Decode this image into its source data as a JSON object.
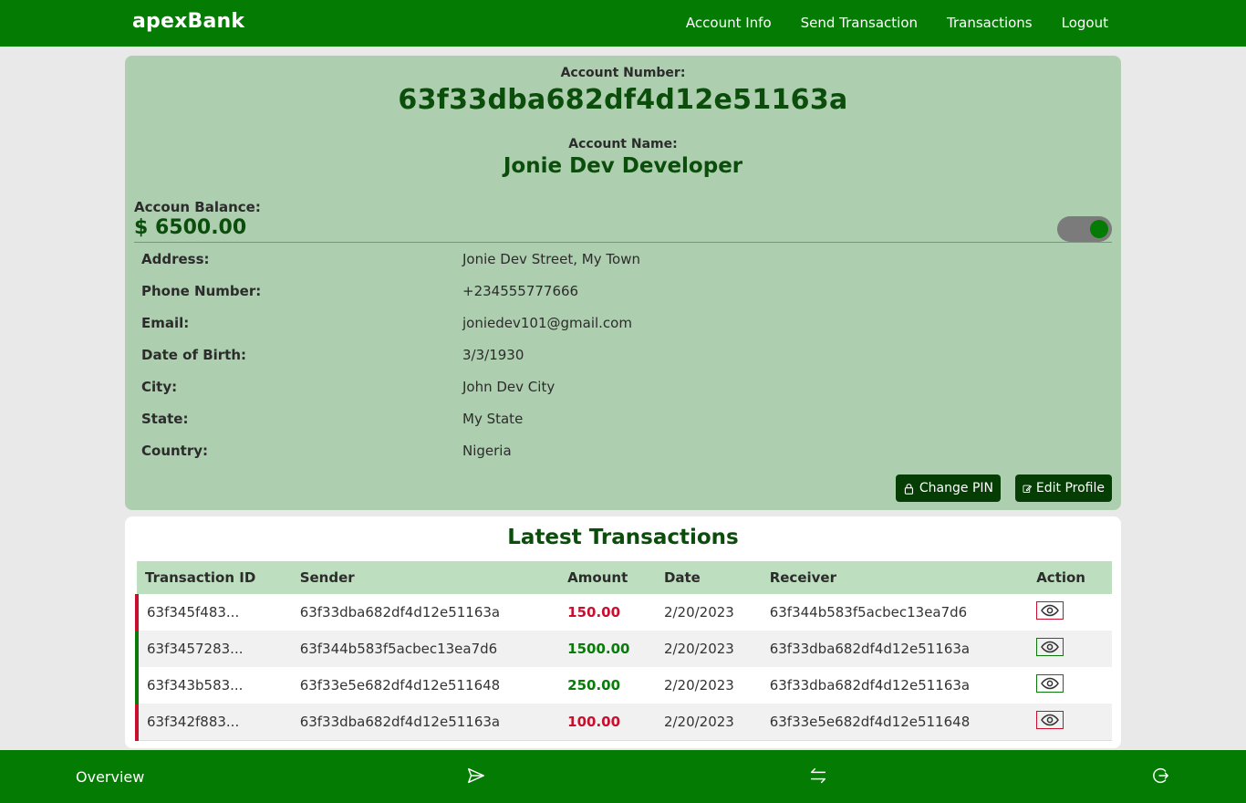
{
  "header": {
    "brand": "apexBank",
    "nav": [
      "Account Info",
      "Send Transaction",
      "Transactions",
      "Logout"
    ]
  },
  "account": {
    "number_label": "Account Number:",
    "number": "63f33dba682df4d12e51163a",
    "name_label": "Account Name:",
    "name": "Jonie Dev Developer",
    "balance_label": "Accoun Balance:",
    "balance": "$ 6500.00",
    "balance_visible_toggle": "on",
    "details": [
      {
        "label": "Address:",
        "value": "Jonie Dev Street, My Town"
      },
      {
        "label": "Phone Number:",
        "value": "+234555777666"
      },
      {
        "label": "Email:",
        "value": "joniedev101@gmail.com"
      },
      {
        "label": "Date of Birth:",
        "value": "3/3/1930"
      },
      {
        "label": "City:",
        "value": "John Dev City"
      },
      {
        "label": "State:",
        "value": "My State"
      },
      {
        "label": "Country:",
        "value": "Nigeria"
      }
    ],
    "change_pin_label": "Change PIN",
    "edit_profile_label": "Edit Profile"
  },
  "transactions": {
    "title": "Latest Transactions",
    "columns": [
      "Transaction ID",
      "Sender",
      "Amount",
      "Date",
      "Receiver",
      "Action"
    ],
    "rows": [
      {
        "id": "63f345f483...",
        "sender": "63f33dba682df4d12e51163a",
        "amount": "150.00",
        "date": "2/20/2023",
        "receiver": "63f344b583f5acbec13ea7d6",
        "type": "debit"
      },
      {
        "id": "63f3457283...",
        "sender": "63f344b583f5acbec13ea7d6",
        "amount": "1500.00",
        "date": "2/20/2023",
        "receiver": "63f33dba682df4d12e51163a",
        "type": "credit"
      },
      {
        "id": "63f343b583...",
        "sender": "63f33e5e682df4d12e511648",
        "amount": "250.00",
        "date": "2/20/2023",
        "receiver": "63f33dba682df4d12e51163a",
        "type": "credit"
      },
      {
        "id": "63f342f883...",
        "sender": "63f33dba682df4d12e51163a",
        "amount": "100.00",
        "date": "2/20/2023",
        "receiver": "63f33e5e682df4d12e511648",
        "type": "debit"
      }
    ]
  },
  "bottom_nav": {
    "overview_label": "Overview",
    "icons": [
      "send-icon",
      "transfer-arrows-icon",
      "logout-icon"
    ]
  },
  "colors": {
    "primary": "#047c04",
    "card_bg": "#adceaf",
    "dark_green": "#0b4d0b",
    "debit": "#c8102e",
    "credit": "#0a7a0a"
  }
}
